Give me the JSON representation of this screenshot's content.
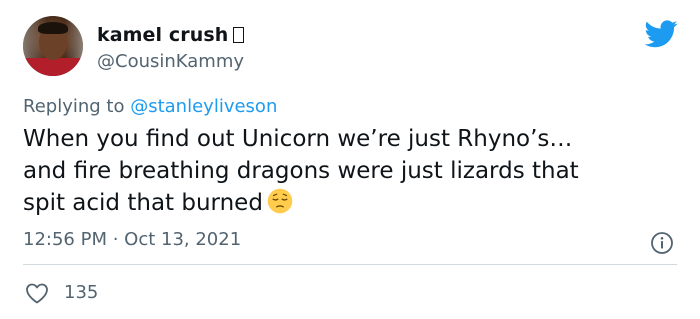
{
  "author": {
    "display_name": "kamel crush",
    "handle": "@CousinKammy",
    "avatar_icon": "user-avatar-photo"
  },
  "brand": {
    "logo_icon": "twitter-bird-icon",
    "color": "#1d9bf0"
  },
  "reply": {
    "prefix": "Replying to",
    "mention": "@stanleyliveson"
  },
  "tweet": {
    "lines": [
      "When you find out Unicorn we’re just Rhyno’s…",
      "and fire breathing dragons were just lizards that",
      "spit acid that burned"
    ],
    "emoji_icon": "pensive-face-emoji",
    "timestamp": "12:56 PM · Oct 13, 2021"
  },
  "actions": {
    "info_icon": "info-icon",
    "like_icon": "heart-outline-icon",
    "like_count": "135"
  },
  "colors": {
    "text_primary": "#0f1419",
    "text_secondary": "#536471",
    "link": "#1d9bf0",
    "divider": "#cfd9de"
  }
}
